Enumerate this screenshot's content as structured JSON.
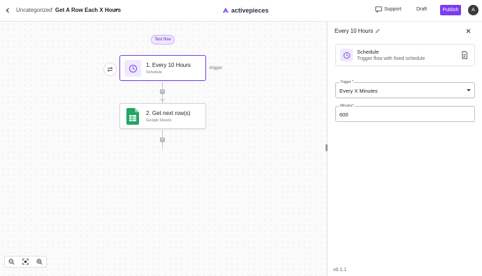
{
  "header": {
    "breadcrumb_folder": "Uncategorized",
    "breadcrumb_sep": "/",
    "flow_name": "Get A Row Each X Hours",
    "logo_text": "activepieces",
    "support_label": "Support",
    "status_label": "Draft",
    "publish_label": "Publish",
    "avatar_initial": "A",
    "accent_color": "#7a3df0"
  },
  "canvas": {
    "test_flow_label": "Test flow",
    "trigger_tag": "trigger",
    "steps": [
      {
        "title": "1. Every 10 Hours",
        "subtitle": "Schedule",
        "icon": "clock-icon"
      },
      {
        "title": "2. Get next row(s)",
        "subtitle": "Google Sheets",
        "icon": "google-sheets-icon"
      }
    ],
    "add_step_symbol": "+"
  },
  "panel": {
    "title": "Every 10 Hours",
    "piece_name": "Schedule",
    "piece_description": "Trigger flow with fixed schedule",
    "trigger_label": "Trigger *",
    "trigger_value": "Every X Minutes",
    "minutes_label": "Minutes*",
    "minutes_value": "600",
    "version": "v0.1.1"
  }
}
